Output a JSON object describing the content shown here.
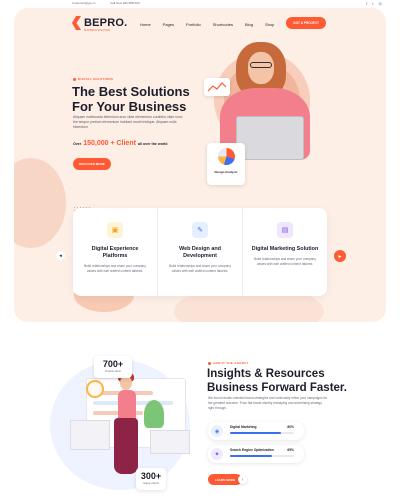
{
  "topbar": {
    "email": "Customer@gm.in",
    "phone": "Call Now 666 888 000",
    "social_icons": [
      "facebook-icon",
      "twitter-icon",
      "instagram-icon"
    ]
  },
  "brand": {
    "logo_text": "BEPRO.",
    "logo_sub": "BUSINESS SOLUTION",
    "accent_color": "#ff5a33"
  },
  "nav": {
    "items": [
      "Home",
      "Pages",
      "Portfolio",
      "Shortcodes",
      "Blog",
      "Shop"
    ],
    "cta_label": "GOT A PROJECT"
  },
  "hero": {
    "tagline": "DIGITAL SOLUTIONS",
    "title": "The Best Solutions For Your Business",
    "description": "Aliquam malesuada bibendum arcu vitae elementum curabitur vitae nunc the tempor pretium elementum habitant morbi tristique. Aliquam nulla bibendum",
    "clients_prefix": "Over",
    "clients_count": "150,000 + Client",
    "clients_suffix": "all over the world",
    "button_label": "DISCOVER MORE",
    "pie_card_label": "Design Analysis"
  },
  "services": [
    {
      "icon": "digital-platform-icon",
      "title": "Digital Experience Platforms",
      "description": "Build relationships and share your company values with well crafted content tailored."
    },
    {
      "icon": "web-design-icon",
      "title": "Web Design and Development",
      "description": "Build relationships and share your company values with well crafted content tailored."
    },
    {
      "icon": "marketing-icon",
      "title": "Digital Marketing Solution",
      "description": "Build relationships and share your company values with well crafted content tailored."
    }
  ],
  "about": {
    "tag": "ABOUT THE AGENCY",
    "title": "Insights & Resources Business Forward Faster.",
    "description": "We found results-oriented brand strategies and continually refine your campaigns for the greatest outcome. From flat brand identity reshaping and advertising strategy right through.",
    "stat_top": {
      "number": "700+",
      "label": "Projects done"
    },
    "stat_bottom": {
      "number": "300+",
      "label": "Happy clients"
    },
    "skills": [
      {
        "name": "Digital Marketing",
        "percent_label": "80%",
        "percent": 80
      },
      {
        "name": "Search Engine Optimization",
        "percent_label": "65%",
        "percent": 65
      }
    ],
    "button_label": "LEARN MORE"
  }
}
